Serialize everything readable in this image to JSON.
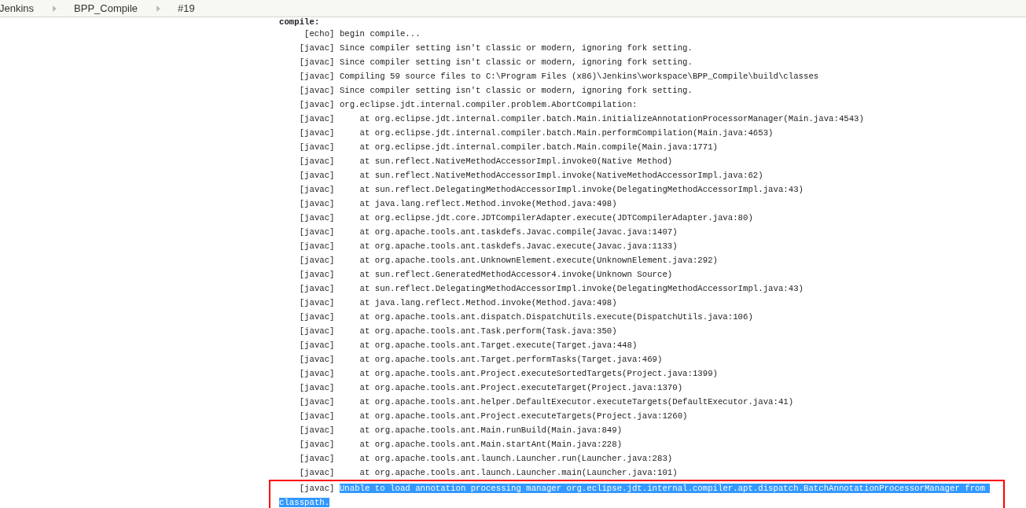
{
  "breadcrumbs": [
    {
      "label": "Jenkins"
    },
    {
      "label": "BPP_Compile"
    },
    {
      "label": "#19"
    }
  ],
  "log": {
    "heading": "compile:",
    "lines": [
      {
        "tag": "[echo]",
        "kind": "message",
        "text": "begin compile...",
        "selected": false,
        "boxed": false
      },
      {
        "tag": "[javac]",
        "kind": "message",
        "text": "Since compiler setting isn't classic or modern, ignoring fork setting.",
        "selected": false,
        "boxed": false
      },
      {
        "tag": "[javac]",
        "kind": "message",
        "text": "Since compiler setting isn't classic or modern, ignoring fork setting.",
        "selected": false,
        "boxed": false
      },
      {
        "tag": "[javac]",
        "kind": "message",
        "text": "Compiling 59 source files to C:\\Program Files (x86)\\Jenkins\\workspace\\BPP_Compile\\build\\classes",
        "selected": false,
        "boxed": false
      },
      {
        "tag": "[javac]",
        "kind": "message",
        "text": "Since compiler setting isn't classic or modern, ignoring fork setting.",
        "selected": false,
        "boxed": false
      },
      {
        "tag": "[javac]",
        "kind": "message",
        "text": "org.eclipse.jdt.internal.compiler.problem.AbortCompilation:",
        "selected": false,
        "boxed": false
      },
      {
        "tag": "[javac]",
        "kind": "trace",
        "text": "at org.eclipse.jdt.internal.compiler.batch.Main.initializeAnnotationProcessorManager(Main.java:4543)",
        "selected": false,
        "boxed": false
      },
      {
        "tag": "[javac]",
        "kind": "trace",
        "text": "at org.eclipse.jdt.internal.compiler.batch.Main.performCompilation(Main.java:4653)",
        "selected": false,
        "boxed": false
      },
      {
        "tag": "[javac]",
        "kind": "trace",
        "text": "at org.eclipse.jdt.internal.compiler.batch.Main.compile(Main.java:1771)",
        "selected": false,
        "boxed": false
      },
      {
        "tag": "[javac]",
        "kind": "trace",
        "text": "at sun.reflect.NativeMethodAccessorImpl.invoke0(Native Method)",
        "selected": false,
        "boxed": false
      },
      {
        "tag": "[javac]",
        "kind": "trace",
        "text": "at sun.reflect.NativeMethodAccessorImpl.invoke(NativeMethodAccessorImpl.java:62)",
        "selected": false,
        "boxed": false
      },
      {
        "tag": "[javac]",
        "kind": "trace",
        "text": "at sun.reflect.DelegatingMethodAccessorImpl.invoke(DelegatingMethodAccessorImpl.java:43)",
        "selected": false,
        "boxed": false
      },
      {
        "tag": "[javac]",
        "kind": "trace",
        "text": "at java.lang.reflect.Method.invoke(Method.java:498)",
        "selected": false,
        "boxed": false
      },
      {
        "tag": "[javac]",
        "kind": "trace",
        "text": "at org.eclipse.jdt.core.JDTCompilerAdapter.execute(JDTCompilerAdapter.java:80)",
        "selected": false,
        "boxed": false
      },
      {
        "tag": "[javac]",
        "kind": "trace",
        "text": "at org.apache.tools.ant.taskdefs.Javac.compile(Javac.java:1407)",
        "selected": false,
        "boxed": false
      },
      {
        "tag": "[javac]",
        "kind": "trace",
        "text": "at org.apache.tools.ant.taskdefs.Javac.execute(Javac.java:1133)",
        "selected": false,
        "boxed": false
      },
      {
        "tag": "[javac]",
        "kind": "trace",
        "text": "at org.apache.tools.ant.UnknownElement.execute(UnknownElement.java:292)",
        "selected": false,
        "boxed": false
      },
      {
        "tag": "[javac]",
        "kind": "trace",
        "text": "at sun.reflect.GeneratedMethodAccessor4.invoke(Unknown Source)",
        "selected": false,
        "boxed": false
      },
      {
        "tag": "[javac]",
        "kind": "trace",
        "text": "at sun.reflect.DelegatingMethodAccessorImpl.invoke(DelegatingMethodAccessorImpl.java:43)",
        "selected": false,
        "boxed": false
      },
      {
        "tag": "[javac]",
        "kind": "trace",
        "text": "at java.lang.reflect.Method.invoke(Method.java:498)",
        "selected": false,
        "boxed": false
      },
      {
        "tag": "[javac]",
        "kind": "trace",
        "text": "at org.apache.tools.ant.dispatch.DispatchUtils.execute(DispatchUtils.java:106)",
        "selected": false,
        "boxed": false
      },
      {
        "tag": "[javac]",
        "kind": "trace",
        "text": "at org.apache.tools.ant.Task.perform(Task.java:350)",
        "selected": false,
        "boxed": false
      },
      {
        "tag": "[javac]",
        "kind": "trace",
        "text": "at org.apache.tools.ant.Target.execute(Target.java:448)",
        "selected": false,
        "boxed": false
      },
      {
        "tag": "[javac]",
        "kind": "trace",
        "text": "at org.apache.tools.ant.Target.performTasks(Target.java:469)",
        "selected": false,
        "boxed": false
      },
      {
        "tag": "[javac]",
        "kind": "trace",
        "text": "at org.apache.tools.ant.Project.executeSortedTargets(Project.java:1399)",
        "selected": false,
        "boxed": false
      },
      {
        "tag": "[javac]",
        "kind": "trace",
        "text": "at org.apache.tools.ant.Project.executeTarget(Project.java:1370)",
        "selected": false,
        "boxed": false
      },
      {
        "tag": "[javac]",
        "kind": "trace",
        "text": "at org.apache.tools.ant.helper.DefaultExecutor.executeTargets(DefaultExecutor.java:41)",
        "selected": false,
        "boxed": false
      },
      {
        "tag": "[javac]",
        "kind": "trace",
        "text": "at org.apache.tools.ant.Project.executeTargets(Project.java:1260)",
        "selected": false,
        "boxed": false
      },
      {
        "tag": "[javac]",
        "kind": "trace",
        "text": "at org.apache.tools.ant.Main.runBuild(Main.java:849)",
        "selected": false,
        "boxed": false
      },
      {
        "tag": "[javac]",
        "kind": "trace",
        "text": "at org.apache.tools.ant.Main.startAnt(Main.java:228)",
        "selected": false,
        "boxed": false
      },
      {
        "tag": "[javac]",
        "kind": "trace",
        "text": "at org.apache.tools.ant.launch.Launcher.run(Launcher.java:283)",
        "selected": false,
        "boxed": false
      },
      {
        "tag": "[javac]",
        "kind": "trace",
        "text": "at org.apache.tools.ant.launch.Launcher.main(Launcher.java:101)",
        "selected": false,
        "boxed": false
      },
      {
        "tag": "[javac]",
        "kind": "message",
        "text": "Unable to load annotation processing manager org.eclipse.jdt.internal.compiler.apt.dispatch.BatchAnnotationProcessorManager from classpath.",
        "selected": true,
        "boxed": true
      }
    ]
  }
}
